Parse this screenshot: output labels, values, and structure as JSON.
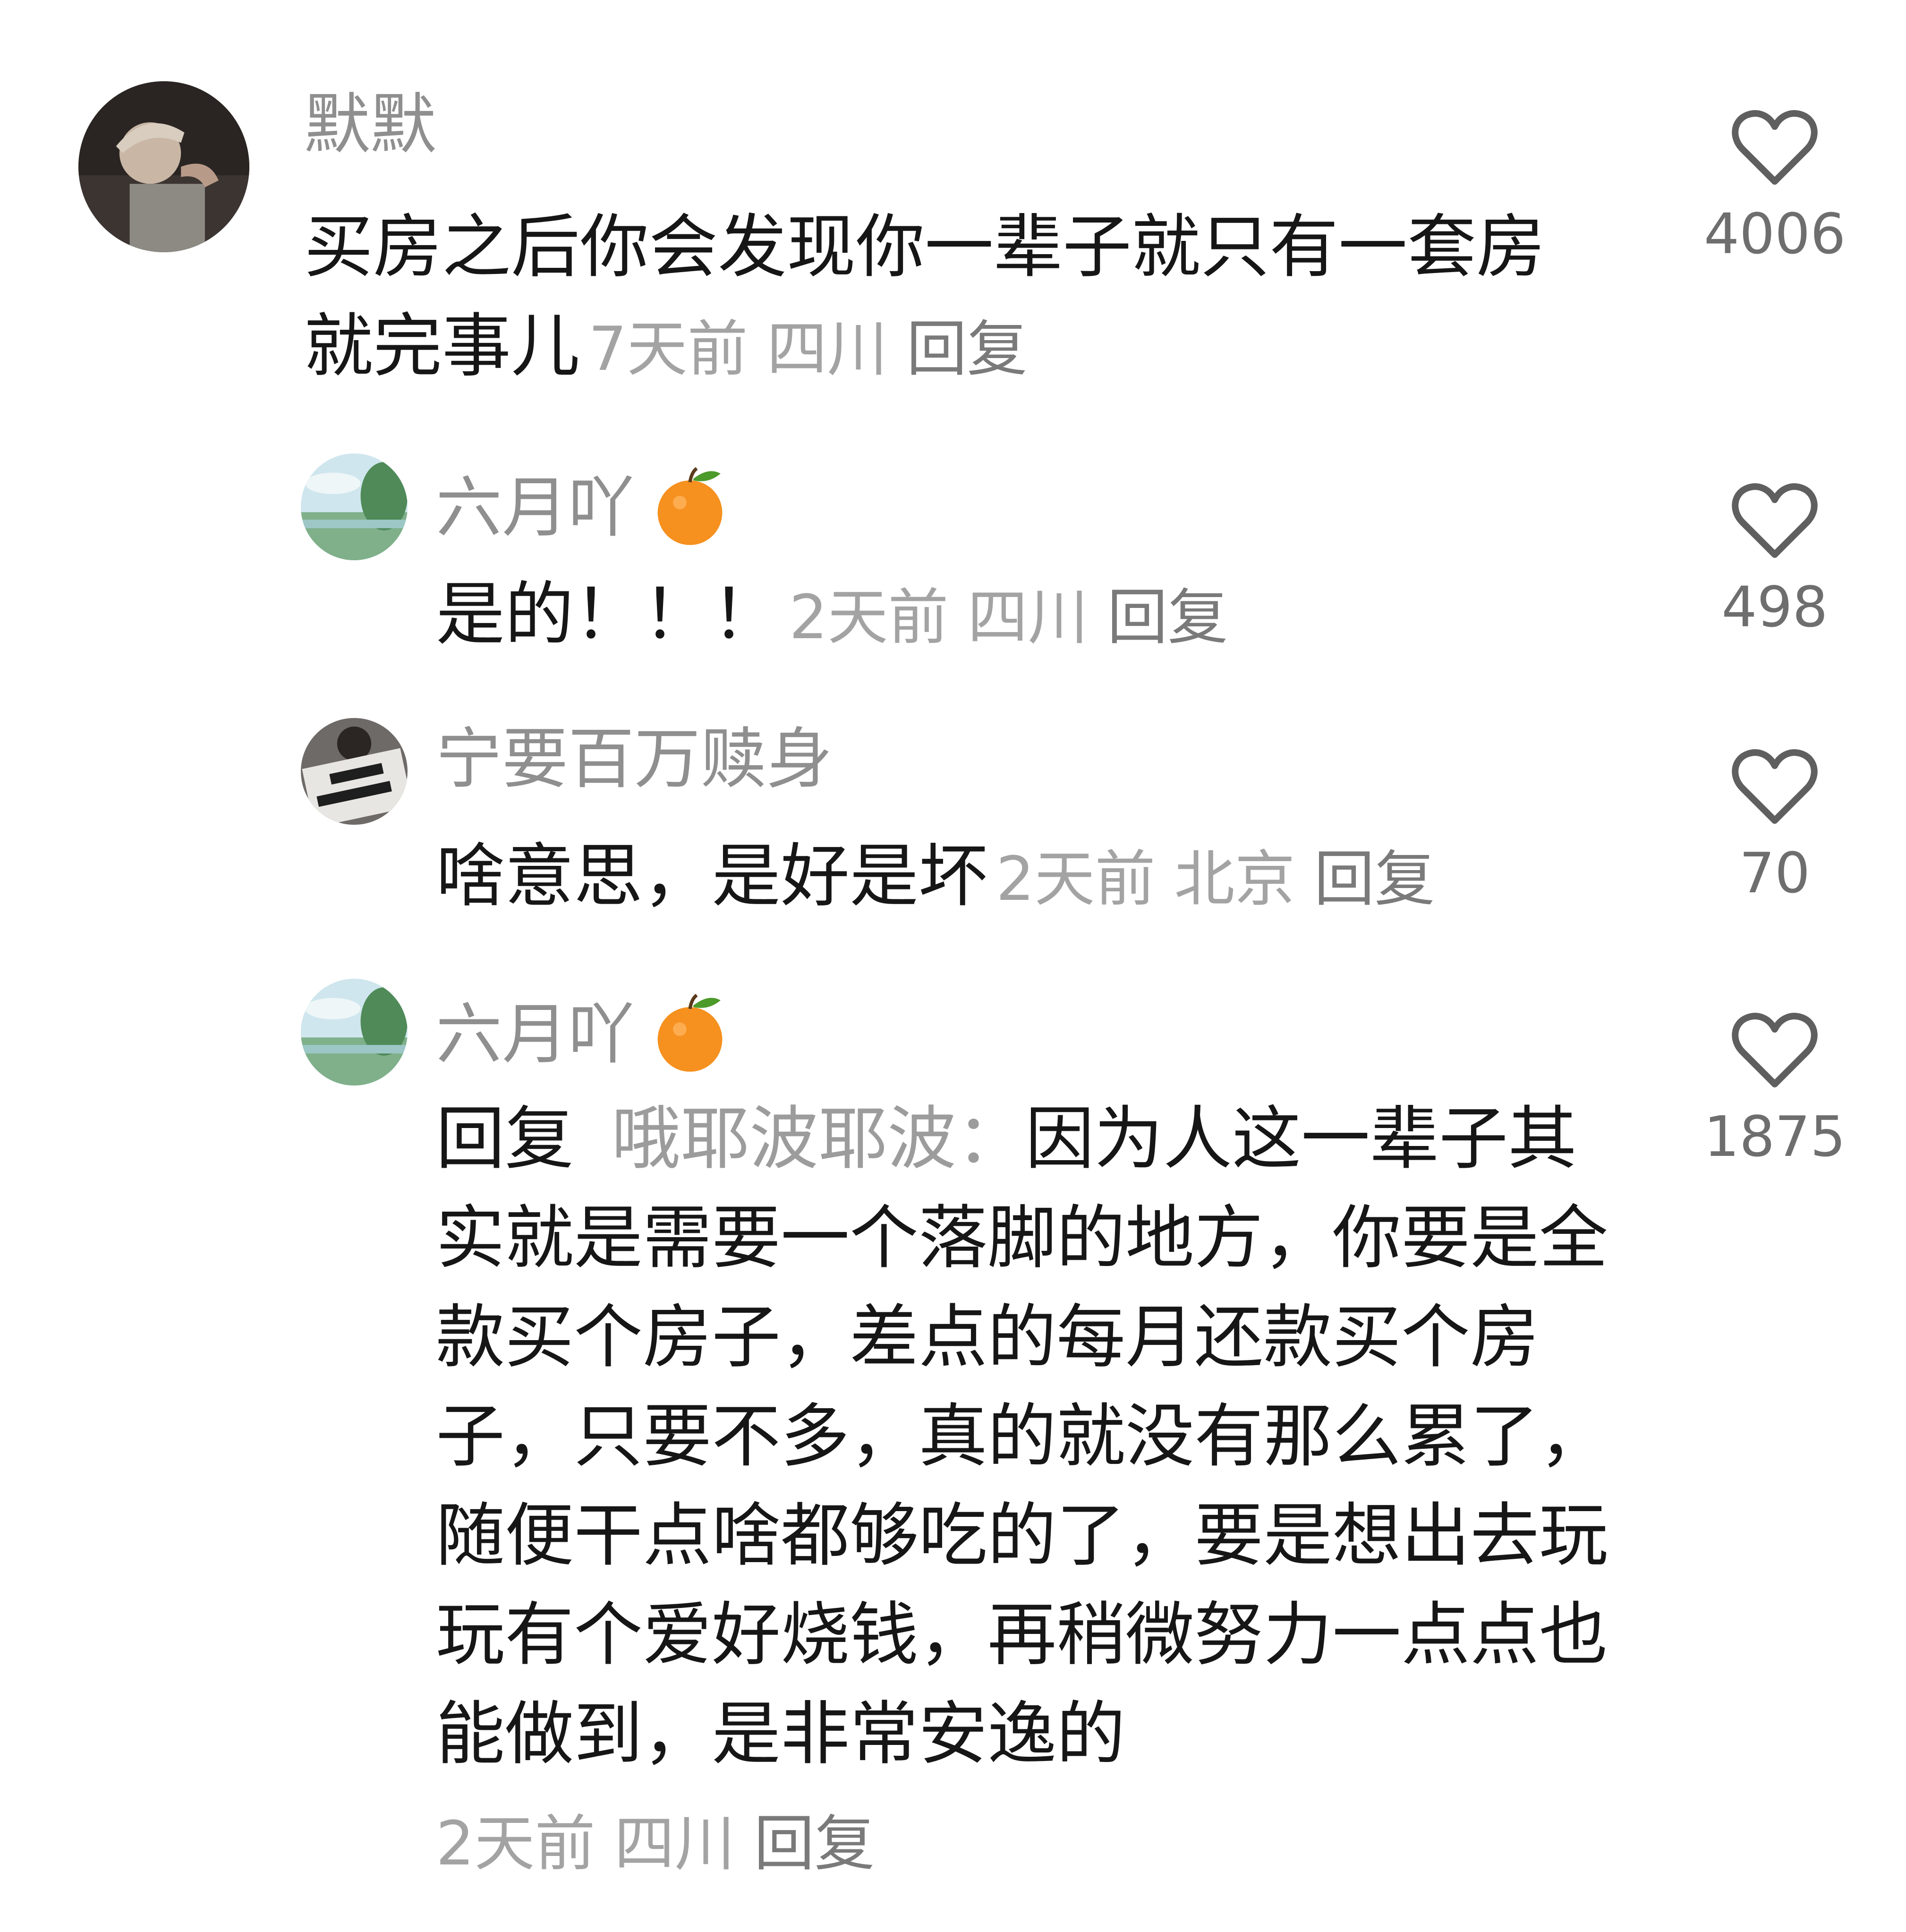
{
  "comments": [
    {
      "username": "默默",
      "text": "买房之后你会发现你一辈子就只有一套房就完事儿",
      "time": "7天前",
      "location": "四川",
      "reply_label": "回复",
      "likes": "4006",
      "avatar": "avatar-photo-person"
    },
    {
      "username": "六月吖",
      "username_emoji": "tangerine-emoji",
      "text": "是的！！！",
      "time": "2天前",
      "location": "四川",
      "reply_label": "回复",
      "likes": "498",
      "avatar": "avatar-painting-landscape"
    },
    {
      "username": "宁要百万赎身",
      "text": "啥意思，是好是坏",
      "time": "2天前",
      "location": "北京",
      "reply_label": "回复",
      "likes": "70",
      "avatar": "avatar-photo-sign-2025"
    },
    {
      "username": "六月吖",
      "username_emoji": "tangerine-emoji",
      "reply_prefix": "回复",
      "reply_target": "哦耶波耶波：",
      "text": "因为人这一辈子其实就是需要一个落脚的地方，你要是全款买个房子，差点的每月还款买个房子，只要不多，真的就没有那么累了，随便干点啥都够吃的了，要是想出去玩玩有个爱好烧钱，再稍微努力一点点也能做到，是非常安逸的",
      "time": "2天前",
      "location": "四川",
      "reply_label": "回复",
      "likes": "1875",
      "avatar": "avatar-painting-landscape"
    }
  ],
  "icons": {
    "like": "heart-outline-icon",
    "emoji": "tangerine-emoji"
  },
  "colors": {
    "username": "#8f8f8f",
    "text": "#161616",
    "meta": "#a3a3a3",
    "like_icon": "#5f5f5f"
  }
}
